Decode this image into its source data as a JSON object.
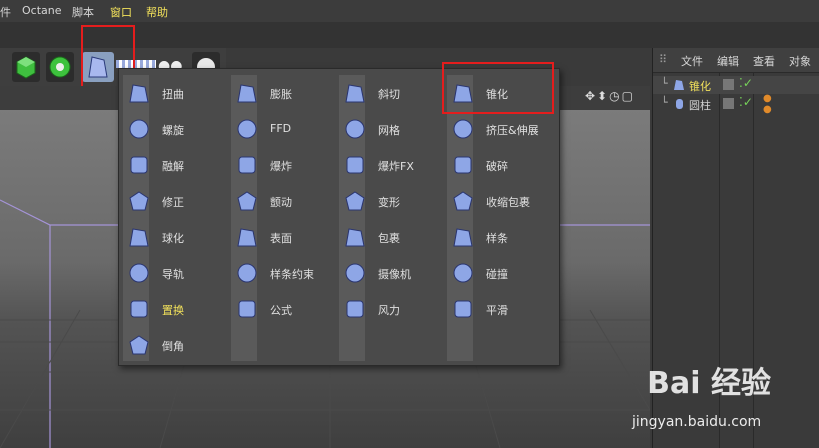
{
  "menubar": {
    "items": [
      "件",
      "Octane",
      "脚本",
      "窗口",
      "帮助"
    ]
  },
  "right_panel": {
    "tabs": [
      "文件",
      "编辑",
      "查看",
      "对象"
    ],
    "objects": [
      {
        "name": "锥化",
        "highlight": true
      },
      {
        "name": "圆柱",
        "highlight": false
      }
    ]
  },
  "deformer_menu": {
    "columns": [
      [
        {
          "label": "扭曲",
          "icon": "twist-icon"
        },
        {
          "label": "螺旋",
          "icon": "spiral-icon"
        },
        {
          "label": "融解",
          "icon": "melt-icon"
        },
        {
          "label": "修正",
          "icon": "correction-icon"
        },
        {
          "label": "球化",
          "icon": "spherify-icon"
        },
        {
          "label": "导轨",
          "icon": "rail-icon"
        },
        {
          "label": "置换",
          "icon": "displace-icon",
          "highlight": true
        },
        {
          "label": "倒角",
          "icon": "bevel-icon"
        }
      ],
      [
        {
          "label": "膨胀",
          "icon": "bulge-icon"
        },
        {
          "label": "FFD",
          "icon": "ffd-icon"
        },
        {
          "label": "爆炸",
          "icon": "explosion-icon"
        },
        {
          "label": "颤动",
          "icon": "jiggle-icon"
        },
        {
          "label": "表面",
          "icon": "surface-icon"
        },
        {
          "label": "样条约束",
          "icon": "spline-wrap-icon"
        },
        {
          "label": "公式",
          "icon": "formula-icon"
        }
      ],
      [
        {
          "label": "斜切",
          "icon": "shear-icon"
        },
        {
          "label": "网格",
          "icon": "mesh-icon"
        },
        {
          "label": "爆炸FX",
          "icon": "explosion-fx-icon"
        },
        {
          "label": "变形",
          "icon": "morph-icon"
        },
        {
          "label": "包裹",
          "icon": "wrap-icon"
        },
        {
          "label": "摄像机",
          "icon": "camera-icon"
        },
        {
          "label": "风力",
          "icon": "wind-icon"
        }
      ],
      [
        {
          "label": "锥化",
          "icon": "taper-icon"
        },
        {
          "label": "挤压&伸展",
          "icon": "squash-stretch-icon"
        },
        {
          "label": "破碎",
          "icon": "shatter-icon"
        },
        {
          "label": "收缩包裹",
          "icon": "shrink-wrap-icon"
        },
        {
          "label": "样条",
          "icon": "spline-icon"
        },
        {
          "label": "碰撞",
          "icon": "collision-icon"
        },
        {
          "label": "平滑",
          "icon": "smoothing-icon"
        }
      ]
    ]
  },
  "watermark": {
    "brand": "Bai 经验",
    "url": "jingyan.baidu.com"
  },
  "colors": {
    "accent_yellow": "#f2e15b",
    "red_box": "#e41d1d",
    "icon_blue": "#8ea6e6"
  }
}
